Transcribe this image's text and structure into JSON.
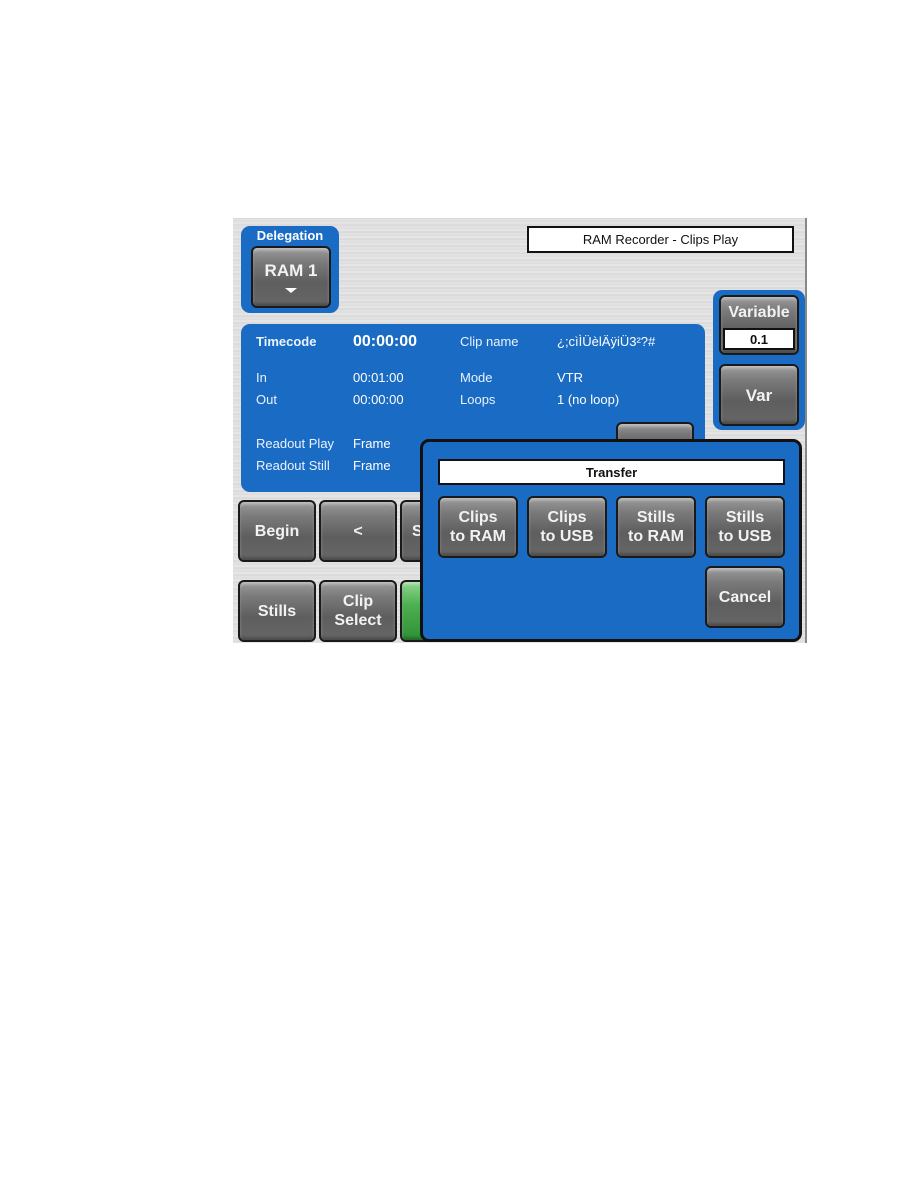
{
  "screen_title": "RAM Recorder - Clips Play",
  "delegation": {
    "label": "Delegation",
    "button": "RAM 1"
  },
  "variable": {
    "label": "Variable",
    "value": "0.1",
    "var_button": "Var"
  },
  "info": {
    "timecode_label": "Timecode",
    "timecode_value": "00:00:00",
    "clipname_label": "Clip name",
    "clipname_value": "¿;cìÌÜèlÄÿiÜ3²?#",
    "in_label": "In",
    "in_value": "00:01:00",
    "out_label": "Out",
    "out_value": "00:00:00",
    "mode_label": "Mode",
    "mode_value": "VTR",
    "loops_label": "Loops",
    "loops_value": "1 (no loop)",
    "readout_play_label": "Readout Play",
    "readout_play_value": "Frame",
    "readout_still_label": "Readout Still",
    "readout_still_value": "Frame"
  },
  "transport": {
    "begin": "Begin",
    "back": "<",
    "partial": "S"
  },
  "bottom": {
    "stills": "Stills",
    "clip_select_1": "Clip",
    "clip_select_2": "Select"
  },
  "transfer_dialog": {
    "title": "Transfer",
    "buttons": [
      {
        "line1": "Clips",
        "line2": "to RAM"
      },
      {
        "line1": "Clips",
        "line2": "to USB"
      },
      {
        "line1": "Stills",
        "line2": "to RAM"
      },
      {
        "line1": "Stills",
        "line2": "to USB"
      }
    ],
    "cancel": "Cancel"
  },
  "colors": {
    "panel_blue": "#1a6bc4",
    "green_button": "#4caf50"
  }
}
